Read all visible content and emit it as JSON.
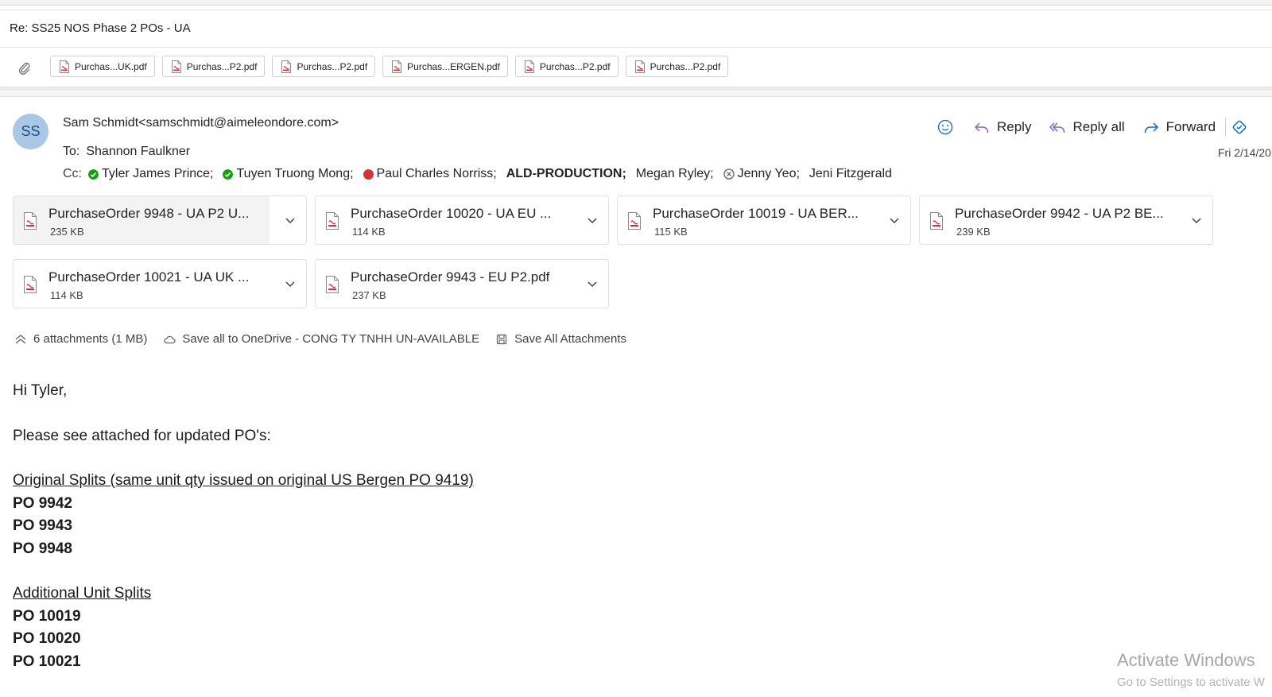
{
  "subject": "Re: SS25 NOS Phase 2 POs - UA",
  "top_attachments": [
    "Purchas...UK.pdf",
    "Purchas...P2.pdf",
    "Purchas...P2.pdf",
    "Purchas...ERGEN.pdf",
    "Purchas...P2.pdf",
    "Purchas...P2.pdf"
  ],
  "sender": {
    "initials": "SS",
    "display": "Sam Schmidt<samschmidt@aimeleondore.com>"
  },
  "to": {
    "label": "To:",
    "name": "Shannon Faulkner"
  },
  "cc": {
    "label": "Cc:",
    "recipients": [
      {
        "name": "Tyler James Prince;",
        "status": "available"
      },
      {
        "name": "Tuyen Truong Mong;",
        "status": "available"
      },
      {
        "name": "Paul Charles Norriss;",
        "status": "busy"
      },
      {
        "name": "ALD-PRODUCTION;",
        "status": "none"
      },
      {
        "name": "Megan Ryley;",
        "status": "none"
      },
      {
        "name": "Jenny Yeo;",
        "status": "blocked"
      },
      {
        "name": "Jeni Fitzgerald",
        "status": "none"
      }
    ]
  },
  "actions": {
    "reply": "Reply",
    "reply_all": "Reply all",
    "forward": "Forward"
  },
  "date": "Fri 2/14/20",
  "attachments": [
    {
      "name": "PurchaseOrder 9948 - UA P2 U...",
      "size": "235 KB"
    },
    {
      "name": "PurchaseOrder 10020 - UA EU ...",
      "size": "114 KB"
    },
    {
      "name": "PurchaseOrder 10019 - UA BER...",
      "size": "115 KB"
    },
    {
      "name": "PurchaseOrder 9942 - UA P2 BE...",
      "size": "239 KB"
    },
    {
      "name": "PurchaseOrder 10021 - UA UK ...",
      "size": "114 KB"
    },
    {
      "name": "PurchaseOrder 9943 - EU P2.pdf",
      "size": "237 KB"
    }
  ],
  "attachment_summary": {
    "count": "6 attachments (1 MB)",
    "save_onedrive": "Save all to OneDrive - CONG TY TNHH UN-AVAILABLE",
    "save_all": "Save All Attachments"
  },
  "body": {
    "greeting": "Hi Tyler,",
    "intro": "Please see attached for updated PO's:",
    "section1_heading": "Original Splits (same unit qty issued on original US Bergen PO 9419)",
    "section1_items": [
      "PO 9942",
      "PO 9943",
      "PO 9948"
    ],
    "section2_heading": "Additional Unit Splits",
    "section2_items": [
      "PO 10019",
      "PO 10020",
      "PO 10021"
    ]
  },
  "watermark": {
    "line1": "Activate Windows",
    "line2": "Go to Settings to activate W"
  }
}
